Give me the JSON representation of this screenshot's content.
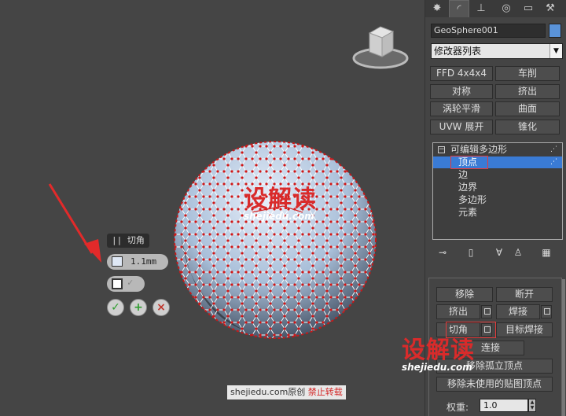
{
  "caddy": {
    "title": "切角",
    "amount_value": "1.1mm"
  },
  "watermark": {
    "brand": "设解读",
    "domain": "shejiedu.com",
    "footer_site": "shejiedu.com原创",
    "footer_warning": "禁止转载"
  },
  "panel": {
    "tabs": [
      "create-tab",
      "modify-tab",
      "hierarchy-tab",
      "motion-tab",
      "display-tab",
      "utilities-tab"
    ],
    "object_name": "GeoSphere001",
    "object_color": "#5a93d9",
    "modifier_list_label": "修改器列表",
    "modifier_buttons": [
      "FFD 4x4x4",
      "车削",
      "对称",
      "挤出",
      "涡轮平滑",
      "曲面",
      "UVW 展开",
      "锥化"
    ],
    "stack": {
      "root_label": "可编辑多边形",
      "items": [
        "顶点",
        "边",
        "边界",
        "多边形",
        "元素"
      ],
      "selected_index": 0
    },
    "edit_vertices": {
      "remove": "移除",
      "break": "断开",
      "extrude": "挤出",
      "weld": "焊接",
      "chamfer": "切角",
      "target_weld": "目标焊接",
      "connect": "连接",
      "remove_isolated": "移除孤立顶点",
      "remove_unused_map": "移除未使用的贴图顶点",
      "weight_label": "权重:",
      "weight_value": "1.0"
    }
  }
}
